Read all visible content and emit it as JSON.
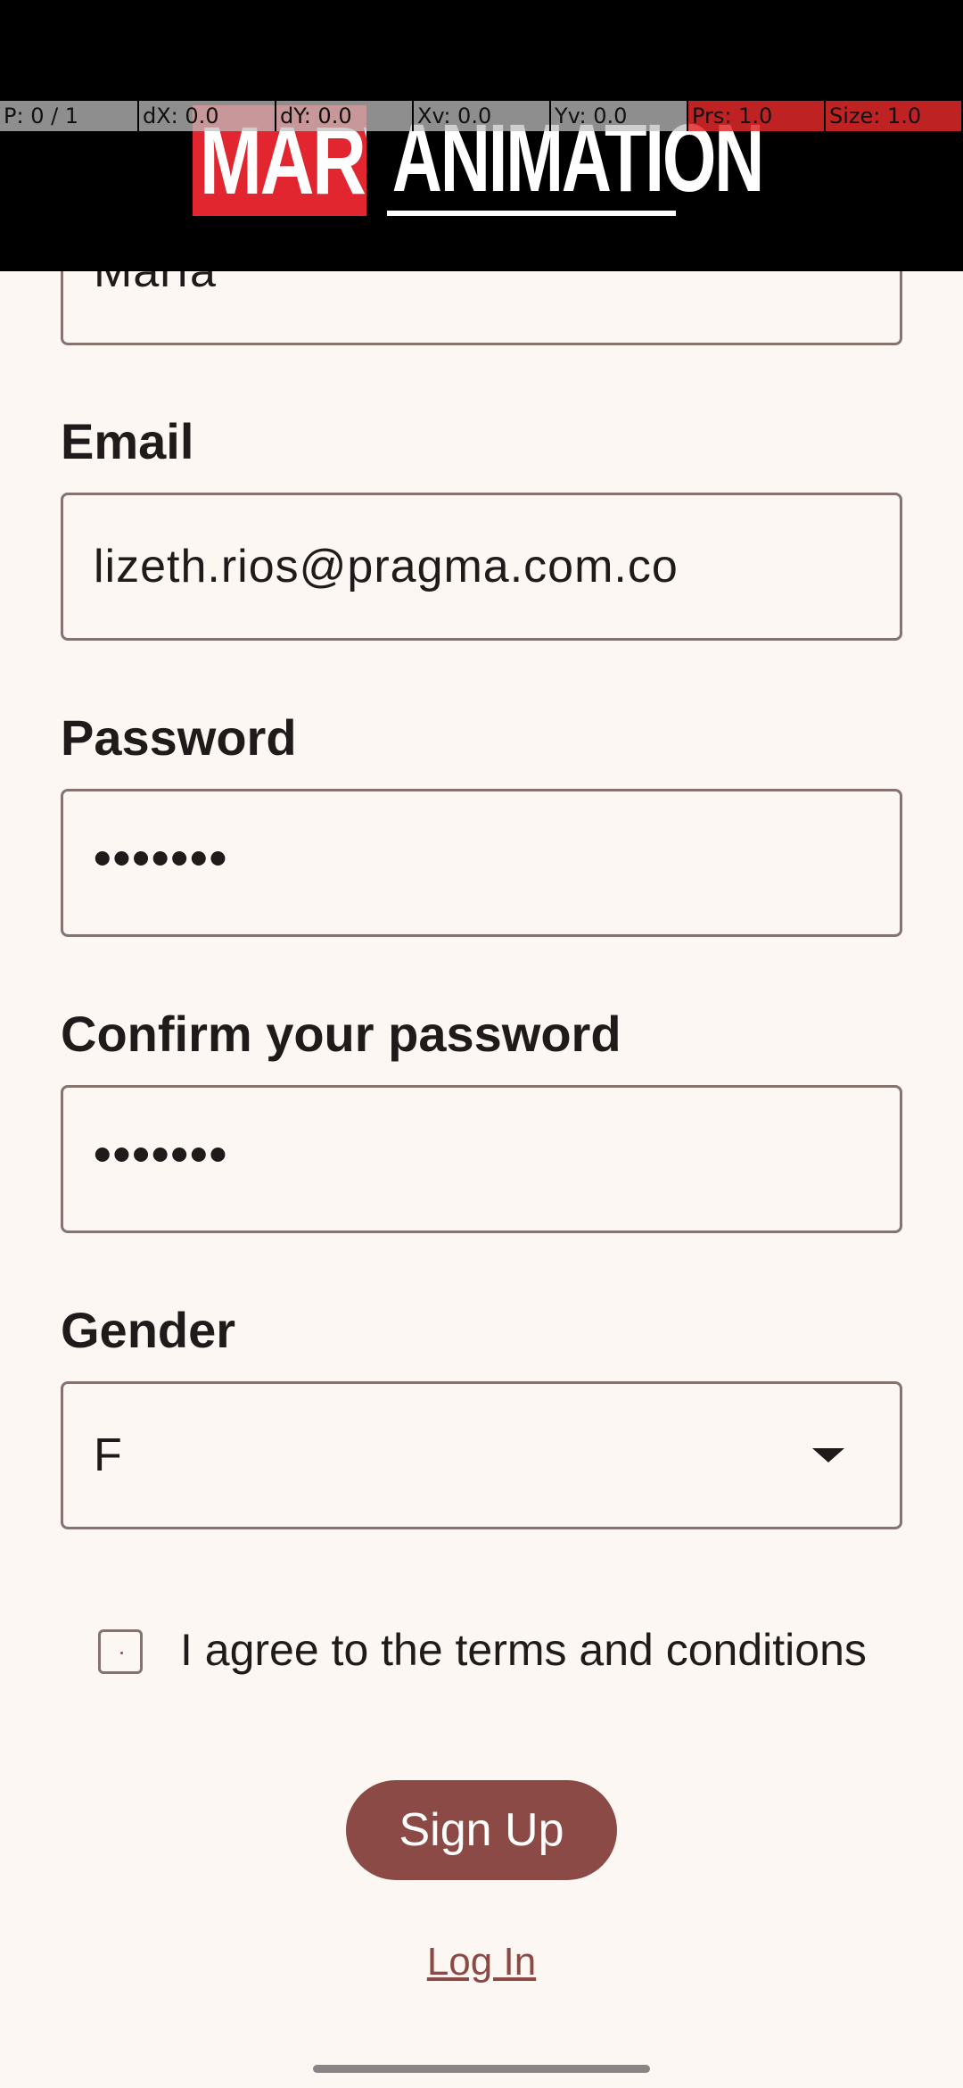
{
  "header": {
    "logo_part1": "MARVEL",
    "logo_part2": "ANIMATION"
  },
  "debug": {
    "p": "P: 0 / 1",
    "dx": "dX: 0.0",
    "dy": "dY: 0.0",
    "xv": "Xv: 0.0",
    "yv": "Yv: 0.0",
    "prs": "Prs: 1.0",
    "size": "Size: 1.0"
  },
  "form": {
    "name_value": "María",
    "email_label": "Email",
    "email_value": "lizeth.rios@pragma.com.co",
    "password_label": "Password",
    "password_value": "•••••••",
    "confirm_label": "Confirm your password",
    "confirm_value": "•••••••",
    "gender_label": "Gender",
    "gender_value": "F",
    "terms_label": "I agree to the terms and conditions",
    "terms_checked": false,
    "signup_label": "Sign Up",
    "login_label": "Log In"
  },
  "colors": {
    "background": "#fcf7f3",
    "primary": "#8b4a45",
    "outline": "#857370",
    "marvel_red": "#e1262f"
  }
}
